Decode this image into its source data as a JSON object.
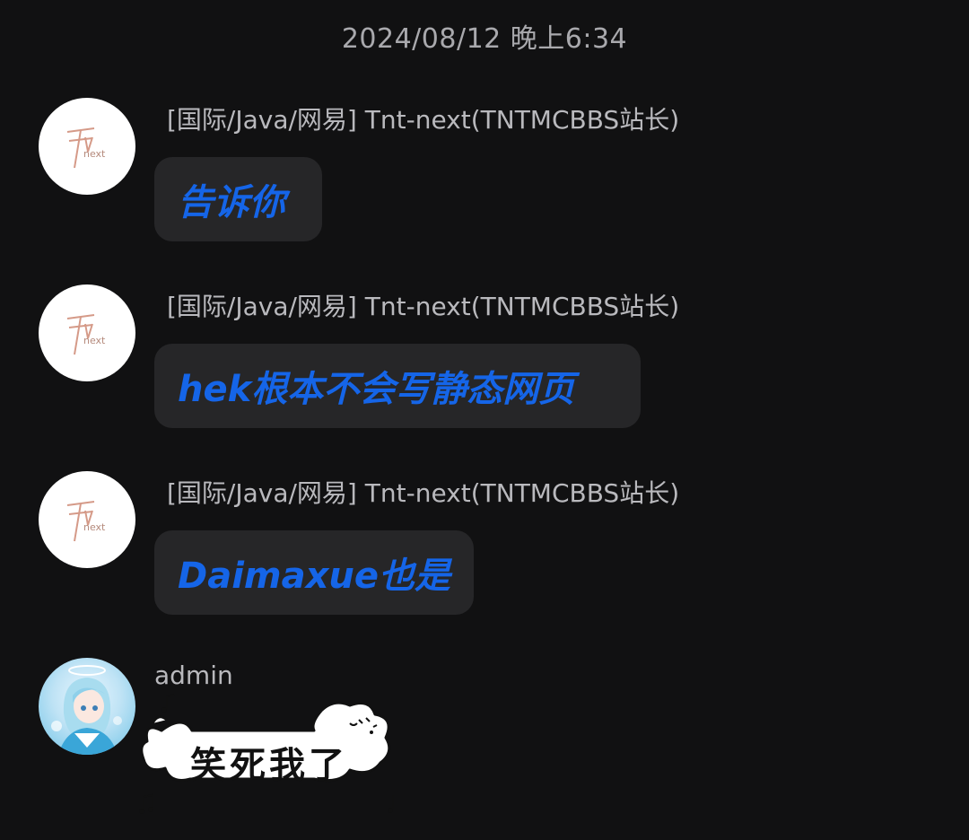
{
  "timestamp": "2024/08/12 晚上6:34",
  "messages": [
    {
      "sender": "[国际/Java/网易] Tnt-next(TNTMCBBS站长)",
      "text": "告诉你"
    },
    {
      "sender": "[国际/Java/网易] Tnt-next(TNTMCBBS站长)",
      "text": "hek根本不会写静态网页"
    },
    {
      "sender": "[国际/Java/网易] Tnt-next(TNTMCBBS站长)",
      "text": "Daimaxue也是"
    }
  ],
  "admin": {
    "name": "admin",
    "sticker_text": "笑死我了"
  },
  "avatar_logo": {
    "mark": "TN",
    "sub": "next"
  },
  "colors": {
    "background": "#111112",
    "bubble": "#262628",
    "message_text": "#1565e8",
    "sender_text": "#b9b9bd"
  }
}
